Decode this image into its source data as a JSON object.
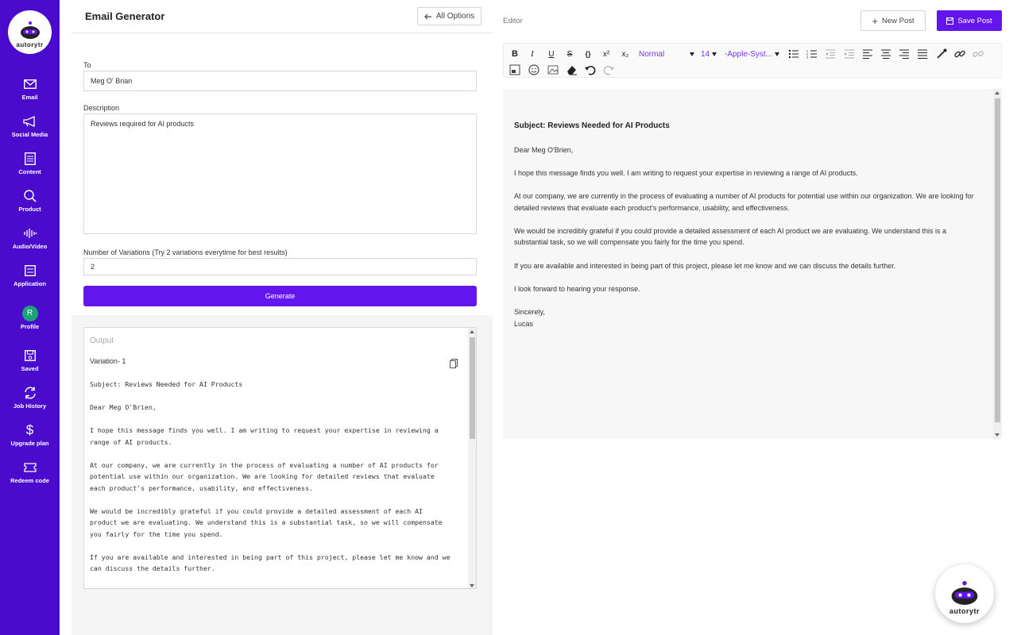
{
  "brand": {
    "name": "autorytr"
  },
  "sidebar": {
    "items": [
      {
        "label": "Email",
        "icon": "mail-icon"
      },
      {
        "label": "Social Media",
        "icon": "megaphone-icon"
      },
      {
        "label": "Content",
        "icon": "document-icon"
      },
      {
        "label": "Product",
        "icon": "search-icon"
      },
      {
        "label": "Audio/Video",
        "icon": "audio-wave-icon"
      },
      {
        "label": "Application",
        "icon": "app-icon"
      },
      {
        "label": "Profile",
        "icon": "avatar",
        "avatar_letter": "R"
      },
      {
        "label": "Saved",
        "icon": "save-icon"
      },
      {
        "label": "Job History",
        "icon": "refresh-icon"
      },
      {
        "label": "Upgrade plan",
        "icon": "dollar-icon"
      },
      {
        "label": "Redeem code",
        "icon": "ticket-icon"
      }
    ]
  },
  "left": {
    "title": "Email Generator",
    "all_options": "All Options",
    "to_label": "To",
    "to_value": "Meg O' Brian",
    "description_label": "Description",
    "description_value": "Reviews required for AI products",
    "variations_label": "Number of Variations (Try 2 variations everytime for best results)",
    "variations_value": "2",
    "generate": "Generate",
    "output_label": "Output",
    "variation_title": "Variation- 1",
    "output_text": "Subject: Reviews Needed for AI Products\n\nDear Meg O'Brien,\n\nI hope this message finds you well. I am writing to request your expertise in reviewing a\nrange of AI products.\n\nAt our company, we are currently in the process of evaluating a number of AI products for\npotential use within our organization. We are looking for detailed reviews that evaluate\neach product's performance, usability, and effectiveness.\n\nWe would be incredibly grateful if you could provide a detailed assessment of each AI\nproduct we are evaluating. We understand this is a substantial task, so we will compensate\nyou fairly for the time you spend.\n\nIf you are available and interested in being part of this project, please let me know and we\ncan discuss the details further."
  },
  "right": {
    "editor_label": "Editor",
    "new_post": "New Post",
    "save_post": "Save Post",
    "toolbar": {
      "style_select": "Normal",
      "size_select": "14",
      "font_select": "-Apple-Syst..."
    },
    "doc": {
      "subject": "Subject: Reviews Needed for AI Products",
      "greeting": "Dear Meg O'Brien,",
      "p1": "I hope this message finds you well. I am writing to request your expertise in reviewing a range of AI products.",
      "p2": "At our company, we are currently in the process of evaluating a number of AI products for potential use within our organization. We are looking for detailed reviews that evaluate each product's performance, usability, and effectiveness.",
      "p3": "We would be incredibly grateful if you could provide a detailed assessment of each AI product we are evaluating. We understand this is a substantial task, so we will compensate you fairly for the time you spend.",
      "p4": "If you are available and interested in being part of this project, please let me know and we can discuss the details further.",
      "p5": "I look forward to hearing your response.",
      "closing": "Sincerely,",
      "signature": "Lucas"
    }
  },
  "colors": {
    "sidebar": "#4a0bcc",
    "accent": "#6315ee",
    "avatar": "#1aa37a"
  }
}
